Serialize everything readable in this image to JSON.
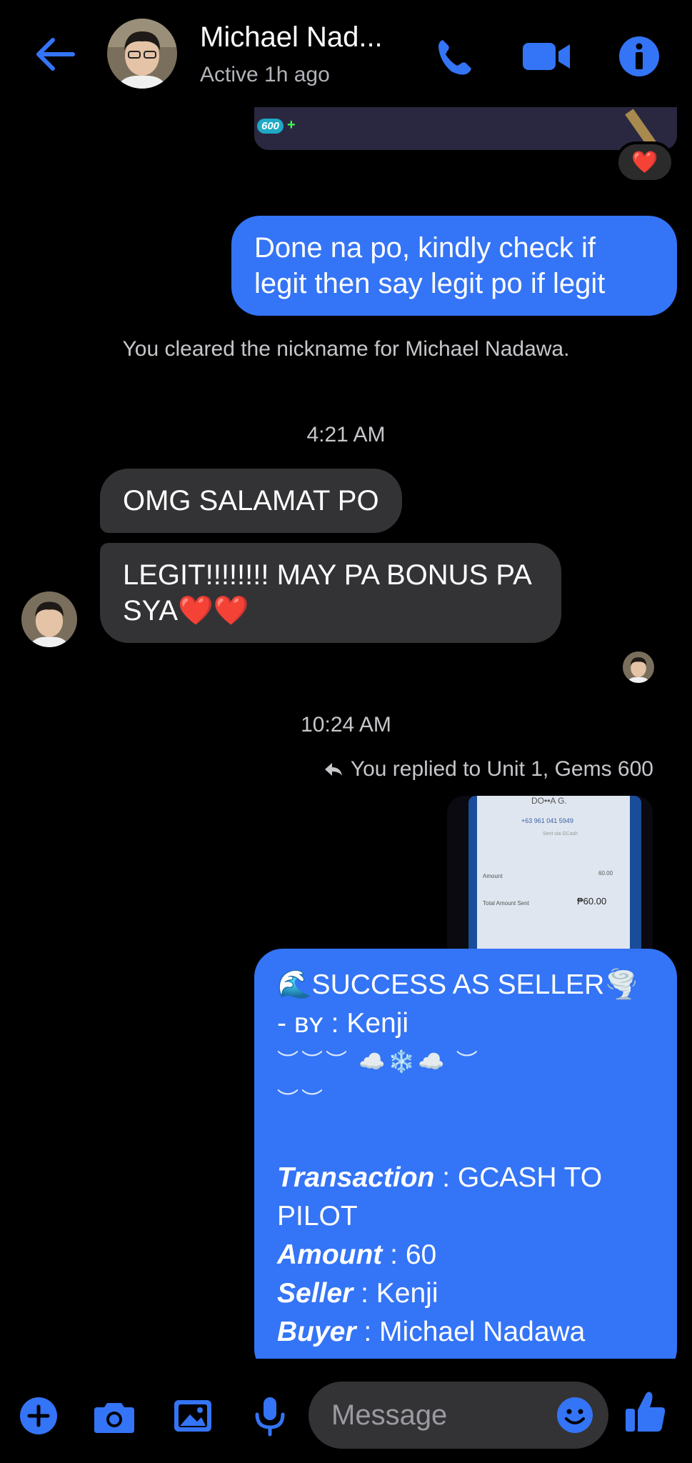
{
  "header": {
    "title": "Michael Nad...",
    "status": "Active 1h ago"
  },
  "messages": {
    "image_badge": "600",
    "reaction": "❤️",
    "outgoing_1": "Done na po, kindly check if legit then say legit po if legit",
    "system_nickname": "You cleared the nickname for Michael Nadawa.",
    "time_1": "4:21 AM",
    "incoming_1": "OMG SALAMAT PO",
    "incoming_2": "LEGIT!!!!!!!! MAY PA BONUS PA SYA❤️❤️",
    "time_2": "10:24 AM",
    "reply_note": "You replied to Unit 1, Gems 600",
    "receipt": {
      "name": "DO••A G.",
      "number": "+63 961 041 5949",
      "sent_via": "Sent via GCash",
      "amount_label": "Amount",
      "amount_value": "60.00",
      "total_label": "Total Amount Sent",
      "total_value": "₱60.00"
    },
    "success_card": {
      "heading": "🌊SUCCESS AS SELLER🌪️",
      "by_prefix": "- ʙʏ : ",
      "by_name": "Kenji",
      "decor_1": "︶︶︶ ☁️❄️☁️ ︶",
      "decor_2": "︶︶",
      "transaction_label": "Transaction",
      "transaction_value": " : GCASH TO PILOT",
      "amount_label": "Amount",
      "amount_value": " : 60",
      "seller_label": "Seller",
      "seller_value": " : Kenji",
      "buyer_label": "Buyer",
      "buyer_value": " : Michael Nadawa"
    }
  },
  "composer": {
    "placeholder": "Message"
  },
  "colors": {
    "accent": "#3474f6",
    "incoming_bubble": "#333335",
    "background": "#000000"
  }
}
